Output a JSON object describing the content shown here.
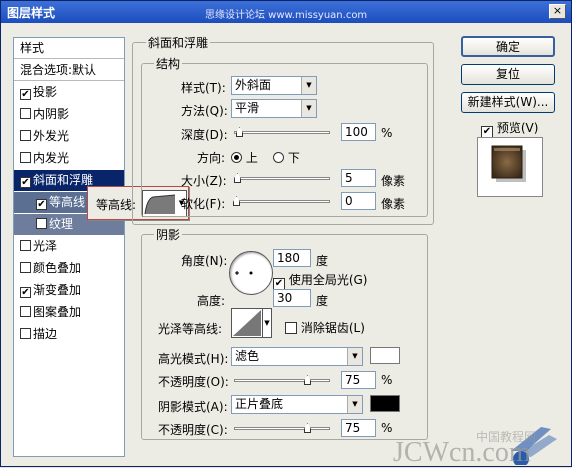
{
  "window": {
    "title": "图层样式",
    "watermark_top": "思缘设计论坛 www.missyuan.com",
    "close_label": "×"
  },
  "left_panel": {
    "items": [
      {
        "label": "样式",
        "checked": null
      },
      {
        "label": "混合选项:默认",
        "checked": null
      },
      {
        "label": "投影",
        "checked": true
      },
      {
        "label": "内阴影",
        "checked": false
      },
      {
        "label": "外发光",
        "checked": false
      },
      {
        "label": "内发光",
        "checked": false
      },
      {
        "label": "斜面和浮雕",
        "checked": true
      },
      {
        "label": "等高线",
        "checked": true
      },
      {
        "label": "纹理",
        "checked": false
      },
      {
        "label": "光泽",
        "checked": false
      },
      {
        "label": "颜色叠加",
        "checked": false
      },
      {
        "label": "渐变叠加",
        "checked": true
      },
      {
        "label": "图案叠加",
        "checked": false
      },
      {
        "label": "描边",
        "checked": false
      }
    ]
  },
  "popup": {
    "label": "等高线:"
  },
  "bevel": {
    "title": "斜面和浮雕",
    "structure": {
      "title": "结构",
      "style_label": "样式(T):",
      "style_value": "外斜面",
      "technique_label": "方法(Q):",
      "technique_value": "平滑",
      "depth_label": "深度(D):",
      "depth_value": "100",
      "depth_unit": "%",
      "direction_label": "方向:",
      "dir_up": "上",
      "dir_down": "下",
      "size_label": "大小(Z):",
      "size_value": "5",
      "size_unit": "像素",
      "soften_label": "软化(F):",
      "soften_value": "0",
      "soften_unit": "像素"
    },
    "shading": {
      "title": "阴影",
      "angle_label": "角度(N):",
      "angle_value": "180",
      "angle_unit": "度",
      "global_light_label": "使用全局光(G)",
      "altitude_label": "高度:",
      "altitude_value": "30",
      "altitude_unit": "度",
      "gloss_label": "光泽等高线:",
      "antialias_label": "消除锯齿(L)",
      "highlight_mode_label": "高光模式(H):",
      "highlight_mode_value": "滤色",
      "highlight_opacity_label": "不透明度(O):",
      "highlight_opacity_value": "75",
      "highlight_opacity_unit": "%",
      "shadow_mode_label": "阴影模式(A):",
      "shadow_mode_value": "正片叠底",
      "shadow_opacity_label": "不透明度(C):",
      "shadow_opacity_value": "75",
      "shadow_opacity_unit": "%",
      "highlight_color": "#ffffff",
      "shadow_color": "#000000"
    }
  },
  "buttons": {
    "ok": "确定",
    "reset": "复位",
    "new_style": "新建样式(W)...",
    "preview": "预览(V)"
  },
  "bottom_watermark": {
    "text": "JCWcn.com",
    "cn": "中国教程网"
  }
}
